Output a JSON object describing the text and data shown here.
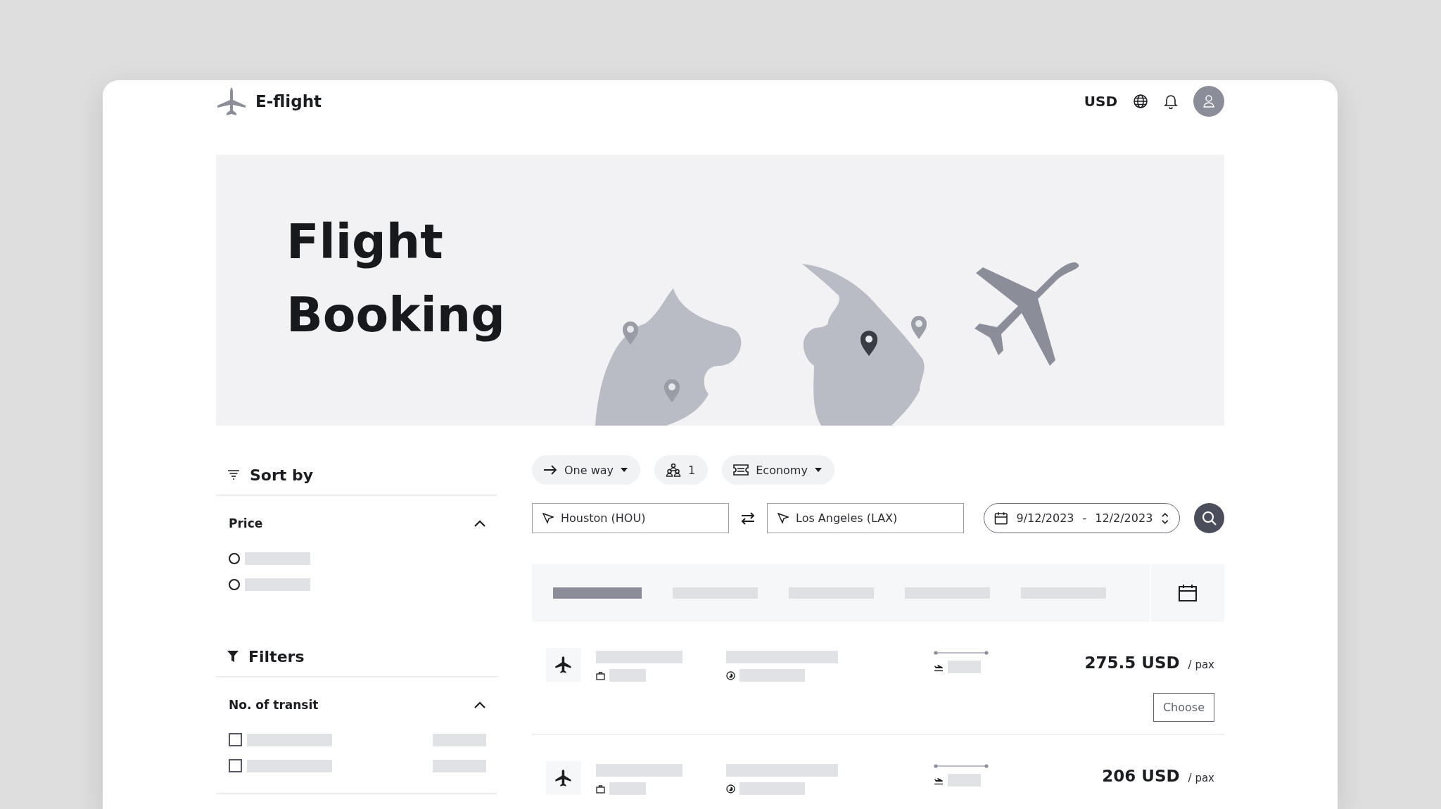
{
  "header": {
    "logo": "E-flight",
    "currency": "USD"
  },
  "hero": {
    "title": "Flight Booking"
  },
  "sort": {
    "title": "Sort by",
    "sections": [
      {
        "title": "Price",
        "expanded": true,
        "kind": "radio",
        "options": [
          {
            "checked": false
          },
          {
            "checked": false
          }
        ]
      }
    ]
  },
  "filters": {
    "title": "Filters",
    "sections": [
      {
        "title": "No. of transit",
        "expanded": true,
        "kind": "checkbox",
        "options": [
          {
            "checked": false
          },
          {
            "checked": false
          }
        ]
      }
    ]
  },
  "search": {
    "trip_type": "One way",
    "passengers": "1",
    "cabin": "Economy",
    "from": "Houston (HOU)",
    "to": "Los Angeles (LAX)",
    "dates": {
      "start": "9/12/2023",
      "separator": "-",
      "end": "12/2/2023"
    }
  },
  "date_tabs": [
    {
      "selected": true
    },
    {
      "selected": false
    },
    {
      "selected": false
    },
    {
      "selected": false
    },
    {
      "selected": false
    }
  ],
  "results": [
    {
      "price": "275.5 USD",
      "unit": "/ pax",
      "button": "Choose"
    },
    {
      "price": "206 USD",
      "unit": "/ pax"
    }
  ]
}
